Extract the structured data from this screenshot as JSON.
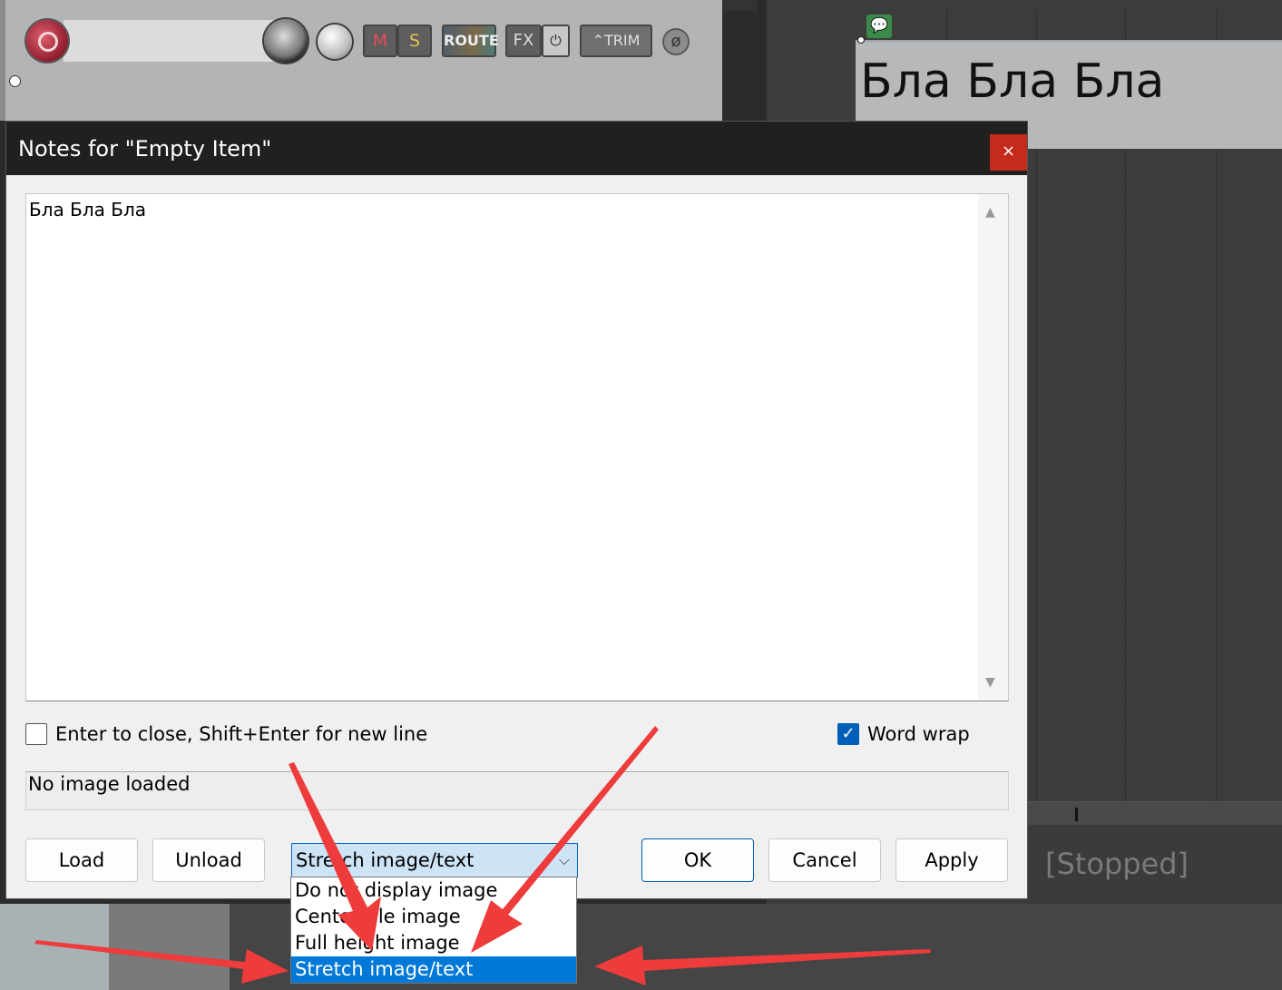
{
  "dialog": {
    "title": "Notes for \"Empty Item\"",
    "close_glyph": "×",
    "notes_text": "Бла Бла Бла",
    "enter_to_close_label": "Enter to close, Shift+Enter for new line",
    "enter_to_close_checked": false,
    "word_wrap_label": "Word wrap",
    "word_wrap_checked": true,
    "image_status": "No image loaded",
    "buttons": {
      "load": "Load",
      "unload": "Unload",
      "ok": "OK",
      "cancel": "Cancel",
      "apply": "Apply"
    },
    "image_display": {
      "selected": "Stretch image/text",
      "options": [
        "Do not display image",
        "Center/tile image",
        "Full height image",
        "Stretch image/text"
      ]
    }
  },
  "track": {
    "mute_label": "M",
    "solo_label": "S",
    "route_label": "ROUTE",
    "fx_label": "FX",
    "trim_label": "TRIM"
  },
  "arrange": {
    "item_text": "Бла Бла Бла",
    "transport_status": "[Stopped]"
  },
  "colors": {
    "accent": "#0078d7",
    "annotation_arrow": "#ee3b3b",
    "close_button": "#c42b1c"
  }
}
